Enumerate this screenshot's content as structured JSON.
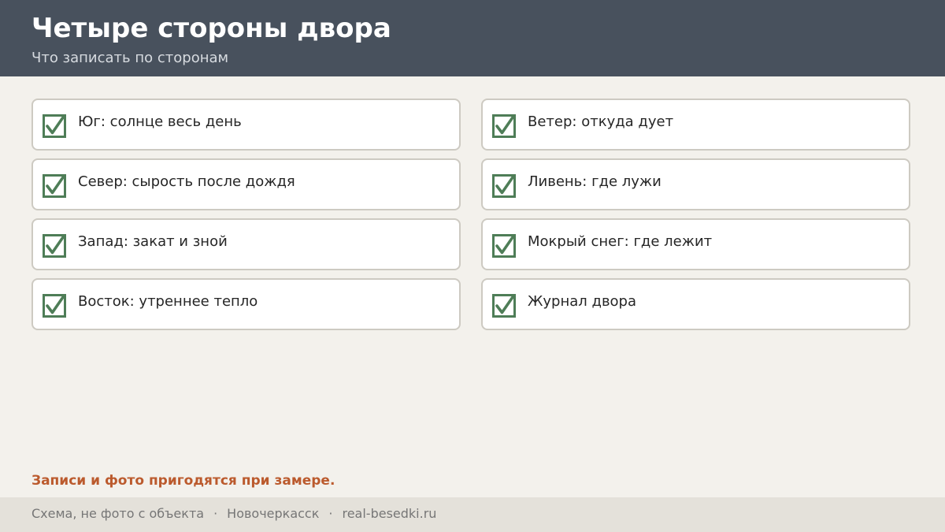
{
  "header": {
    "title": "Четыре стороны двора",
    "subtitle": "Что записать по сторонам"
  },
  "items": [
    {
      "label": "Юг: солнце весь день",
      "checked": true
    },
    {
      "label": "Ветер: откуда дует",
      "checked": true
    },
    {
      "label": "Север: сырость после дождя",
      "checked": true
    },
    {
      "label": "Ливень: где лужи",
      "checked": true
    },
    {
      "label": "Запад: закат и зной",
      "checked": true
    },
    {
      "label": "Мокрый снег: где лежит",
      "checked": true
    },
    {
      "label": "Восток: утреннее тепло",
      "checked": true
    },
    {
      "label": "Журнал двора",
      "checked": true
    }
  ],
  "note": "Записи и фото пригодятся при замере.",
  "footer": {
    "caption": "Схема, не фото с объекта",
    "separator": "·",
    "city": "Новочеркасск",
    "site": "real-besedki.ru"
  },
  "colors": {
    "header_bg": "#48515d",
    "page_bg": "#f3f1ec",
    "check_green": "#4e7d57",
    "accent": "#bb5a2d",
    "footer_bg": "#e4e1da"
  }
}
